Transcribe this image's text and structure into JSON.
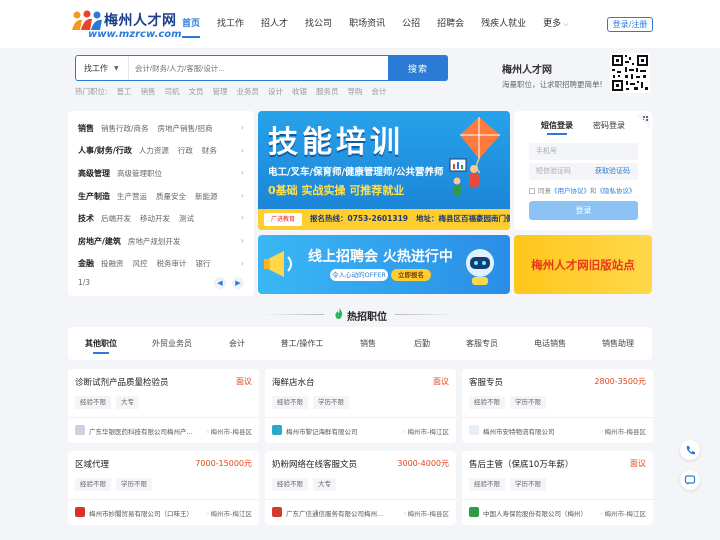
{
  "logo": {
    "title": "梅州人才网",
    "url": "www.mzrcw.com"
  },
  "nav": {
    "items": [
      "首页",
      "找工作",
      "招人才",
      "找公司",
      "职场资讯",
      "公招",
      "招聘会",
      "残疾人就业",
      "更多"
    ],
    "login": "登录/注册",
    "accent": "#2b7bd6"
  },
  "search": {
    "type": "找工作",
    "placeholder": "会计/财务/人力/客服/设计...",
    "button": "搜索",
    "hot_label": "热门职位:",
    "hot": [
      "普工",
      "销售",
      "司机",
      "文员",
      "管理",
      "业务员",
      "设计",
      "收银",
      "服务员",
      "导购",
      "会计"
    ]
  },
  "site": {
    "name": "梅州人才网",
    "slogan": "海量职位，让求职招聘更简单!"
  },
  "categories": {
    "rows": [
      {
        "name": "销售",
        "subs": [
          "销售行政/商务",
          "房地产销售/招商"
        ]
      },
      {
        "name": "人事/财务/行政",
        "subs": [
          "人力资源",
          "行政",
          "财务"
        ]
      },
      {
        "name": "高级管理",
        "subs": [
          "高级管理职位"
        ]
      },
      {
        "name": "生产制造",
        "subs": [
          "生产营运",
          "质量安全",
          "新能源"
        ]
      },
      {
        "name": "技术",
        "subs": [
          "后端开发",
          "移动开发",
          "测试"
        ]
      },
      {
        "name": "房地产/建筑",
        "subs": [
          "房地产规划开发"
        ]
      },
      {
        "name": "金融",
        "subs": [
          "投融资",
          "风控",
          "税务审计",
          "银行"
        ]
      }
    ],
    "pager": "1/3"
  },
  "banner_main": {
    "title": "技能培训",
    "line1": "电工/叉车/保育师/健康管理师/公共营养师",
    "line2": "0基础  实战实操  可推荐就业",
    "brand": "广进教育",
    "phone": "报名热线：0753-2601319",
    "address": "地址：梅县区百福豪园南门侧"
  },
  "banner_online": {
    "title": "线上招聘会 火热进行中",
    "pill": "令人心动的OFFER",
    "go": "立即报名"
  },
  "banner_old": {
    "text": "梅州人才网旧版站点"
  },
  "login": {
    "tab_sms": "短信登录",
    "tab_pwd": "密码登录",
    "phone_placeholder": "手机号",
    "code_placeholder": "短信验证码",
    "get_code": "获取验证码",
    "agree_prefix": "同意",
    "agreement": "《用户协议》",
    "and": "和",
    "privacy": "《隐私协议》",
    "submit": "登录"
  },
  "hot_section": {
    "title": "热招职位",
    "tabs": [
      "其他职位",
      "外贸业务员",
      "会计",
      "普工/操作工",
      "销售",
      "后勤",
      "客服专员",
      "电话销售",
      "销售助理"
    ]
  },
  "jobs": [
    {
      "title": "诊断试剂产品质量检验员",
      "salary": "面议",
      "tags": [
        "经验不限",
        "大专"
      ],
      "company": "广东华银医药科技有限公司梅州产...",
      "location": "梅州市-梅县区",
      "logo_color": "#c9d3de"
    },
    {
      "title": "海鲜店水台",
      "salary": "面议",
      "tags": [
        "经验不限",
        "学历不限"
      ],
      "company": "梅州市黎记海鲜有限公司",
      "location": "梅州市-梅江区",
      "logo_color": "#2aa9c9"
    },
    {
      "title": "客服专员",
      "salary": "2800-3500元",
      "tags": [
        "经验不限",
        "学历不限"
      ],
      "company": "梅州市安特物流有限公司",
      "location": "梅州市-梅县区",
      "logo_color": "#e8eef5"
    },
    {
      "title": "区域代理",
      "salary": "7000-15000元",
      "tags": [
        "经验不限",
        "学历不限"
      ],
      "company": "梅州市妙閣贸易有限公司（口味王）",
      "location": "梅州市-梅江区",
      "logo_color": "#d9342b"
    },
    {
      "title": "奶粉网络在线客服文员",
      "salary": "3000-4000元",
      "tags": [
        "经验不限",
        "大专"
      ],
      "company": "广东广信通信服务有限公司梅州...",
      "location": "梅州市-梅县区",
      "logo_color": "#d33a2c"
    },
    {
      "title": "售后主管（保底10万年薪）",
      "salary": "面议",
      "tags": [
        "经验不限",
        "学历不限"
      ],
      "company": "中国人寿保险股份有限公司（梅州）",
      "location": "梅州市-梅江区",
      "logo_color": "#2f9b46"
    }
  ]
}
